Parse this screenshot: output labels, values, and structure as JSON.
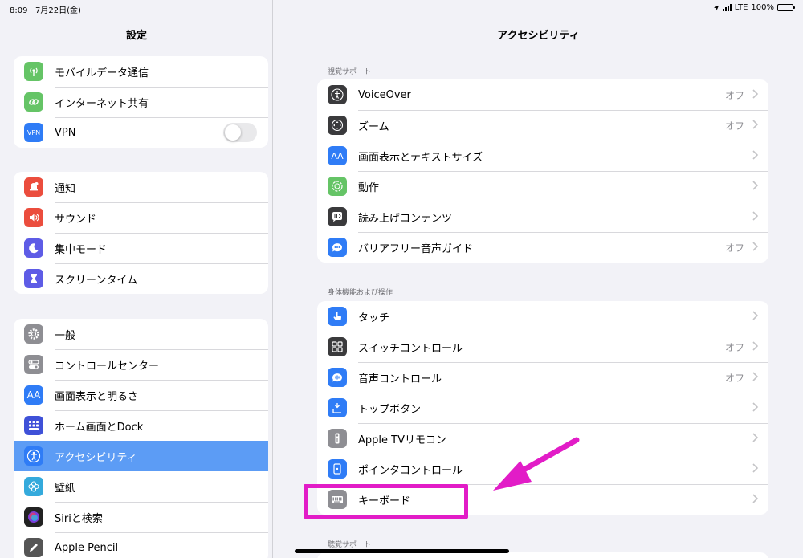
{
  "status": {
    "time": "8:09",
    "date": "7月22日(金)",
    "network": "LTE",
    "battery": "100%"
  },
  "sidebar": {
    "title": "設定",
    "group1": [
      {
        "label": "モバイルデータ通信",
        "icon": "antenna-icon",
        "color": "#65c466"
      },
      {
        "label": "インターネット共有",
        "icon": "link-icon",
        "color": "#65c466"
      },
      {
        "label": "VPN",
        "icon": "vpn-icon",
        "color": "#2f7cf6",
        "toggle": "off"
      }
    ],
    "group2": [
      {
        "label": "通知",
        "icon": "bell-icon",
        "color": "#eb4d3d"
      },
      {
        "label": "サウンド",
        "icon": "speaker-icon",
        "color": "#eb4d3d"
      },
      {
        "label": "集中モード",
        "icon": "moon-icon",
        "color": "#5e5ce6"
      },
      {
        "label": "スクリーンタイム",
        "icon": "hourglass-icon",
        "color": "#5e5ce6"
      }
    ],
    "group3": [
      {
        "label": "一般",
        "icon": "gear-icon",
        "color": "#8e8e93"
      },
      {
        "label": "コントロールセンター",
        "icon": "switches-icon",
        "color": "#8e8e93"
      },
      {
        "label": "画面表示と明るさ",
        "icon": "text-size-icon",
        "color": "#2f7cf6"
      },
      {
        "label": "ホーム画面とDock",
        "icon": "grid-icon",
        "color": "#3f51d8"
      },
      {
        "label": "アクセシビリティ",
        "icon": "accessibility-icon",
        "color": "#2f7cf6",
        "selected": true
      },
      {
        "label": "壁紙",
        "icon": "flower-icon",
        "color": "#34aadc"
      },
      {
        "label": "Siriと検索",
        "icon": "siri-icon",
        "color": "#222222"
      },
      {
        "label": "Apple Pencil",
        "icon": "pencil-icon",
        "color": "#555555"
      }
    ]
  },
  "main": {
    "title": "アクセシビリティ",
    "section1": {
      "header": "視覚サポート",
      "rows": [
        {
          "label": "VoiceOver",
          "value": "オフ",
          "icon": "voiceover-icon",
          "color": "#3a3a3c"
        },
        {
          "label": "ズーム",
          "value": "オフ",
          "icon": "zoom-icon",
          "color": "#3a3a3c"
        },
        {
          "label": "画面表示とテキストサイズ",
          "value": "",
          "icon": "text-size-icon",
          "color": "#2f7cf6"
        },
        {
          "label": "動作",
          "value": "",
          "icon": "motion-icon",
          "color": "#65c466"
        },
        {
          "label": "読み上げコンテンツ",
          "value": "",
          "icon": "speech-icon",
          "color": "#3a3a3c"
        },
        {
          "label": "バリアフリー音声ガイド",
          "value": "オフ",
          "icon": "audio-description-icon",
          "color": "#2f7cf6"
        }
      ]
    },
    "section2": {
      "header": "身体機能および操作",
      "rows": [
        {
          "label": "タッチ",
          "value": "",
          "icon": "touch-icon",
          "color": "#2f7cf6"
        },
        {
          "label": "スイッチコントロール",
          "value": "オフ",
          "icon": "switch-control-icon",
          "color": "#3a3a3c"
        },
        {
          "label": "音声コントロール",
          "value": "オフ",
          "icon": "voice-control-icon",
          "color": "#2f7cf6"
        },
        {
          "label": "トップボタン",
          "value": "",
          "icon": "top-button-icon",
          "color": "#2f7cf6"
        },
        {
          "label": "Apple TVリモコン",
          "value": "",
          "icon": "remote-icon",
          "color": "#8e8e93"
        },
        {
          "label": "ポインタコントロール",
          "value": "",
          "icon": "pointer-icon",
          "color": "#2f7cf6"
        },
        {
          "label": "キーボード",
          "value": "",
          "icon": "keyboard-icon",
          "color": "#8e8e93"
        }
      ]
    },
    "section3": {
      "header": "聴覚サポート"
    }
  },
  "annotation": {
    "color": "#e21cc7"
  }
}
